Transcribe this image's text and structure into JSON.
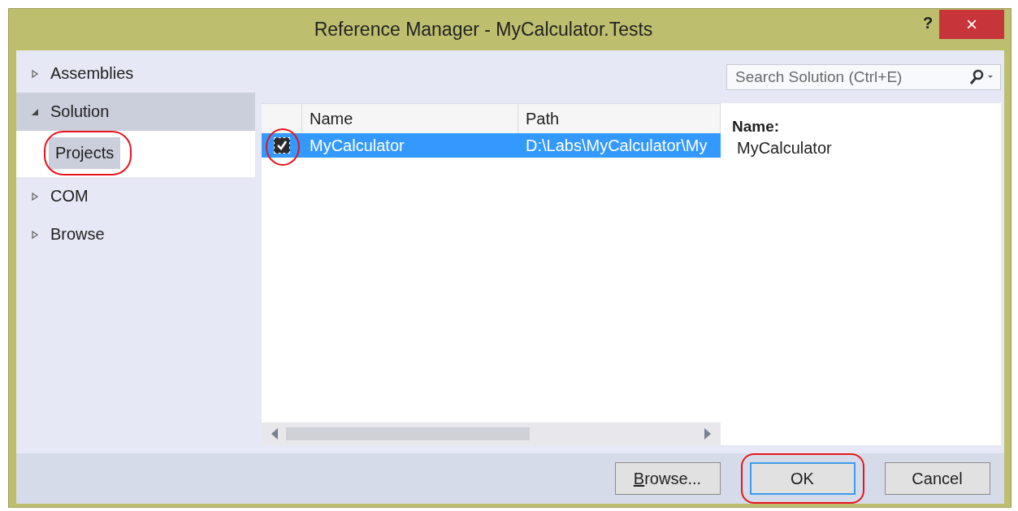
{
  "window": {
    "title": "Reference Manager - MyCalculator.Tests",
    "help": "?",
    "close": "×"
  },
  "sidebar": {
    "items": [
      {
        "label": "Assemblies",
        "expanded": false,
        "selected": false
      },
      {
        "label": "Solution",
        "expanded": true,
        "selected": true,
        "children": [
          {
            "label": "Projects",
            "selected": true,
            "annotated": true
          }
        ]
      },
      {
        "label": "COM",
        "expanded": false,
        "selected": false
      },
      {
        "label": "Browse",
        "expanded": false,
        "selected": false
      }
    ]
  },
  "search": {
    "placeholder": "Search Solution (Ctrl+E)"
  },
  "table": {
    "columns": [
      "Name",
      "Path"
    ],
    "rows": [
      {
        "checked": true,
        "selected": true,
        "annotated": true,
        "name": "MyCalculator",
        "path": "D:\\Labs\\MyCalculator\\My"
      }
    ]
  },
  "details": {
    "label": "Name:",
    "value": "MyCalculator"
  },
  "buttons": [
    {
      "label": "Browse...",
      "access_key": true,
      "default": false,
      "annotated": false
    },
    {
      "label": "OK",
      "access_key": false,
      "default": true,
      "annotated": true
    },
    {
      "label": "Cancel",
      "access_key": false,
      "default": false,
      "annotated": false
    }
  ]
}
